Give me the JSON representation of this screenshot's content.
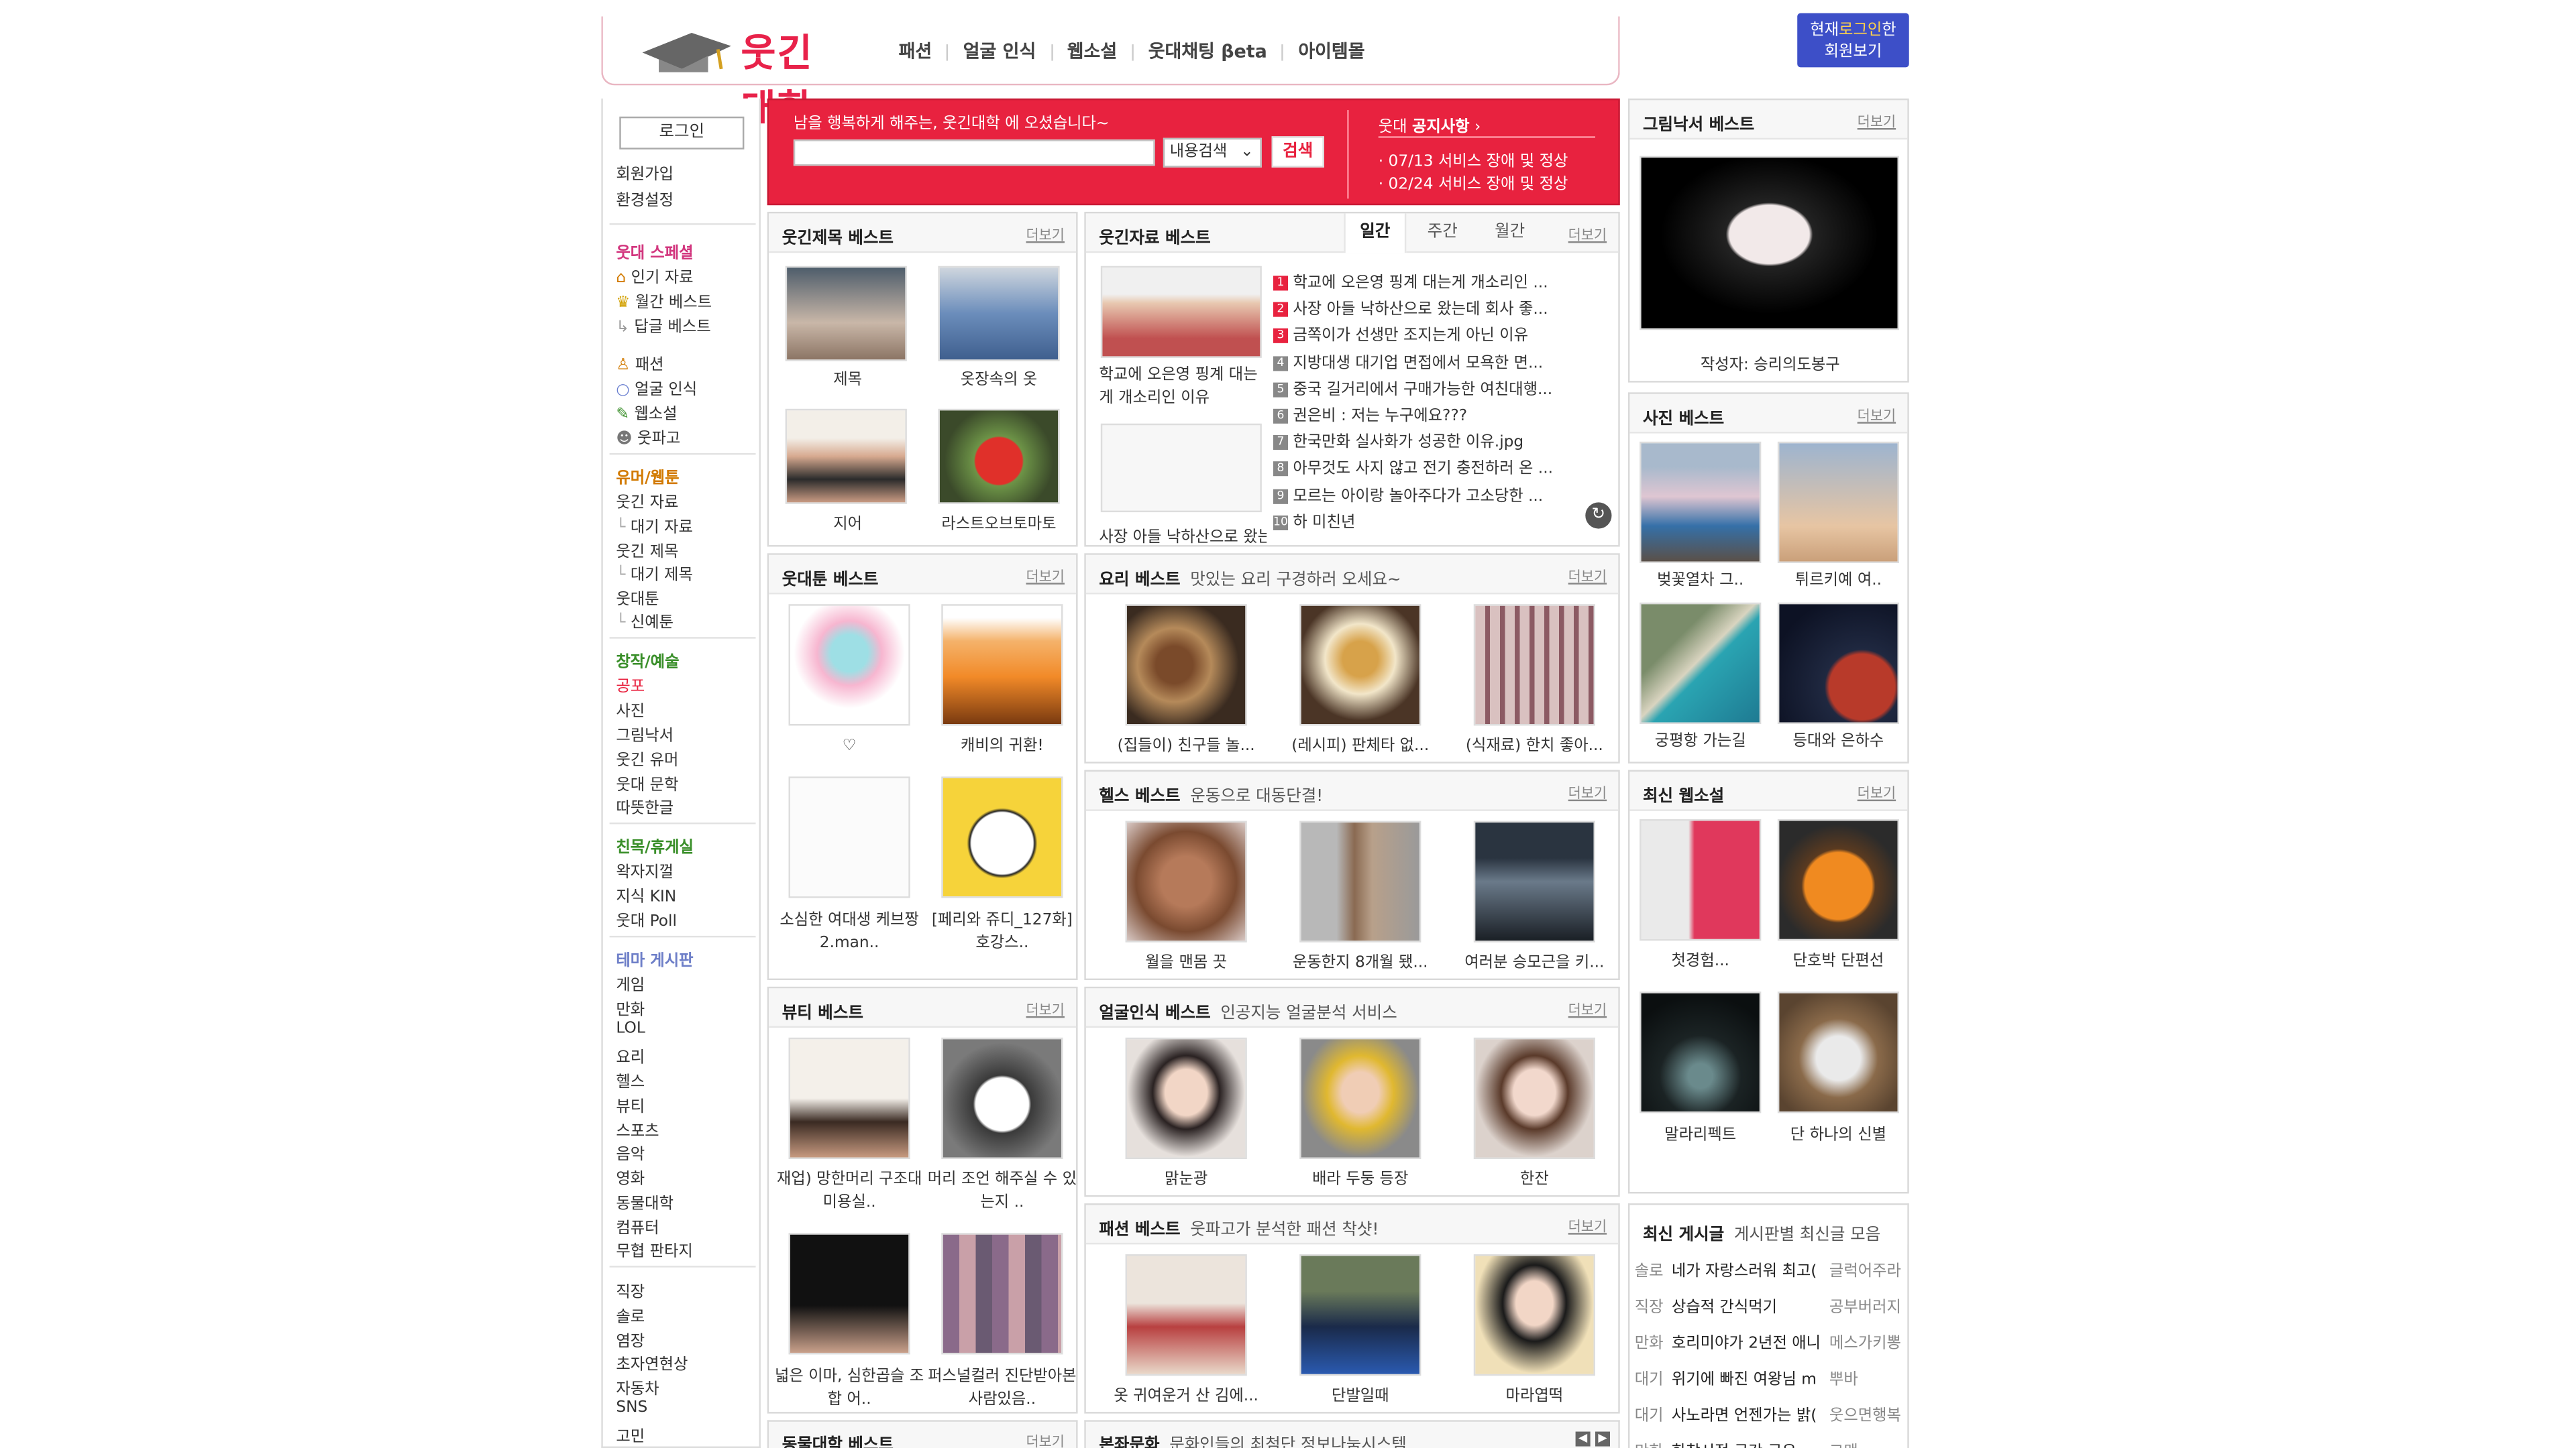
{
  "header": {
    "logo_text": "웃긴대학",
    "nav": [
      "패션",
      "얼굴 인식",
      "웹소설",
      "웃대채팅 βeta",
      "아이템몰"
    ],
    "login_now": {
      "line1_prefix": "현재",
      "line1_highlight": "로그인",
      "line1_suffix": "한",
      "line2": "회원보기"
    }
  },
  "sidebar": {
    "login_button": "로그인",
    "account_links": [
      "회원가입",
      "환경설정"
    ],
    "special_head": "웃대 스페셜",
    "special_items": [
      "인기 자료",
      "월간 베스트",
      "답글 베스트"
    ],
    "feature_items": [
      "패션",
      "얼굴 인식",
      "웹소설",
      "웃파고"
    ],
    "humor_head": "유머/웹툰",
    "humor_items": [
      "웃긴 자료",
      "대기 자료",
      "웃긴 제목",
      "대기 제목",
      "웃대툰",
      "신예툰"
    ],
    "creative_head": "창작/예술",
    "creative_items": [
      "공포",
      "사진",
      "그림낙서",
      "웃긴 유머",
      "웃대 문학",
      "따뜻한글"
    ],
    "social_head": "친목/휴게실",
    "social_items": [
      "왁자지껄",
      "지식 KIN",
      "웃대 Poll"
    ],
    "theme_head": "테마 게시판",
    "theme_items": [
      "게임",
      "만화",
      "LOL",
      "요리",
      "헬스",
      "뷰티",
      "스포츠",
      "음악",
      "영화",
      "동물대학",
      "컴퓨터",
      "무협 판타지"
    ],
    "misc_items": [
      "직장",
      "솔로",
      "염장",
      "초자연현상",
      "자동차",
      "SNS",
      "고민"
    ]
  },
  "banner": {
    "welcome": "남을 행복하게 해주는, 웃긴대학 에 오셨습니다~",
    "search_placeholder": "",
    "search_select": "내용검색",
    "search_button": "검색",
    "notice_prefix": "웃대",
    "notice_title": "공지사항",
    "notices": [
      "07/13 서비스 장애 및 정상",
      "02/24 서비스 장애 및 정상"
    ]
  },
  "more_label": "더보기",
  "funny_title_best": {
    "title": "웃긴제목 베스트",
    "items": [
      "제목",
      "옷장속의 옷",
      "지어",
      "라스트오브토마토"
    ]
  },
  "funny_data_best": {
    "title": "웃긴자료 베스트",
    "tabs": [
      "일간",
      "주간",
      "월간"
    ],
    "featured": [
      "학교에 오은영 핑계 대는게 개소리인 이유",
      "사장 아들 낙하산으로 왔는데 회사 좋은..."
    ],
    "list": [
      "학교에 오은영 핑계 대는게 개소리인 ...",
      "사장 아들 낙하산으로 왔는데 회사 좋...",
      "금쪽이가 선생만 조지는게 아닌 이유",
      "지방대생 대기업 면접에서 모욕한 면...",
      "중국 길거리에서 구매가능한 여친대행...",
      "권은비 : 저는 누구에요???",
      "한국만화 실사화가 성공한 이유.jpg",
      "아무것도 사지 않고 전기 충전하러 온 ...",
      "모르는 아이랑 놀아주다가 고소당한 ...",
      "하 미친년"
    ]
  },
  "right_sketch": {
    "title": "그림낙서 베스트",
    "author": "작성자: 승리의도봉구"
  },
  "photo_best": {
    "title": "사진 베스트",
    "items": [
      "벚꽃열차 그..",
      "튀르키예 여..",
      "궁평항 가는길",
      "등대와 은하수"
    ]
  },
  "webtoon_best": {
    "title": "웃대툰 베스트",
    "items": [
      "♡",
      "캐비의 귀환!",
      "소심한 여대생 케브짱 2.man..",
      "[페리와 쥬디_127화] 호강스.."
    ]
  },
  "cooking_best": {
    "title": "요리 베스트",
    "sub": "맛있는 요리 구경하러 오세요~",
    "items": [
      "(집들이) 친구들 놀...",
      "(레시피) 판체타 없...",
      "(식재료) 한치 좋아..."
    ]
  },
  "novel_best": {
    "title": "최신 웹소설",
    "items": [
      "첫경험...",
      "단호박 단편선",
      "말라리펙트",
      "단 하나의 신별"
    ]
  },
  "health_best": {
    "title": "헬스 베스트",
    "sub": "운동으로 대동단결!",
    "items": [
      "월을 맨몸 끗",
      "운동한지 8개월 됐...",
      "여러분 승모근을 키..."
    ]
  },
  "beauty_best": {
    "title": "뷰티 베스트",
    "items": [
      "재업) 망한머리 구조대 미용실..",
      "머리 조언 해주실 수 있는지 ..",
      "넓은 이마, 심한곱슬 조합 어..",
      "퍼스널컬러 진단받아본 사람있음.."
    ]
  },
  "face_best": {
    "title": "얼굴인식 베스트",
    "sub": "인공지능 얼굴분석 서비스",
    "items": [
      "맑눈광",
      "배라 두둥 등장",
      "한잔"
    ]
  },
  "latest_posts": {
    "title": "최신 게시글",
    "sub": "게시판별 최신글 모음",
    "rows": [
      {
        "cat": "솔로",
        "text": "네가 자랑스러워 최고(",
        "author": "글럭어주라"
      },
      {
        "cat": "직장",
        "text": "상습적 간식먹기",
        "author": "공부버러지"
      },
      {
        "cat": "만화",
        "text": "호리미야가 2년전 애니",
        "author": "메스가키뽕"
      },
      {
        "cat": "대기",
        "text": "위기에 빠진 여왕님 m",
        "author": "뿌바"
      },
      {
        "cat": "대기",
        "text": "사노라면 언젠가는 밝(",
        "author": "웃으면행복"
      },
      {
        "cat": "만화",
        "text": "한참시적 근간 근우",
        "author": "고맨"
      }
    ]
  },
  "fashion_best": {
    "title": "패션 베스트",
    "sub": "웃파고가 분석한 패션 착샷!",
    "items": [
      "옷 귀여운거 산 김에...",
      "단발일때",
      "마라엽떡"
    ]
  },
  "animal_best": {
    "title": "동물대학 베스트"
  },
  "culture_best": {
    "title": "본좌문화",
    "sub": "문화인들의 최첨단 정보나눔시스템"
  },
  "colors": {
    "brand_red": "#e8223f",
    "login_blue": "#3d4fc8",
    "special_head": "#d2367e",
    "section_head": "#d27a00",
    "creative_head": "#3a8f2a",
    "theme_head": "#6e7fc8"
  }
}
